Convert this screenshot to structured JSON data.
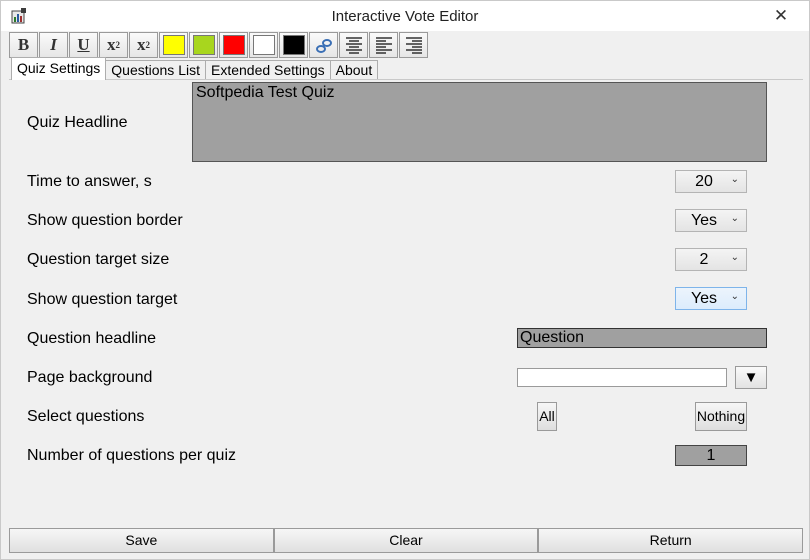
{
  "window": {
    "title": "Interactive Vote Editor",
    "close_glyph": "✕"
  },
  "toolbar": {
    "bold": "B",
    "italic": "I",
    "underline": "U",
    "superscript_base": "x",
    "superscript_exp": "2",
    "subscript_base": "x",
    "subscript_exp": "2",
    "swatches": [
      "#ffff00",
      "#a8d61e",
      "#ff0000",
      "#ffffff",
      "#000000"
    ]
  },
  "tabs": [
    "Quiz Settings",
    "Questions List",
    "Extended Settings",
    "About"
  ],
  "settings": {
    "quiz_headline_label": "Quiz Headline",
    "quiz_headline_value": "Softpedia Test Quiz",
    "time_label": "Time to answer, s",
    "time_value": "20",
    "border_label": "Show question border",
    "border_value": "Yes",
    "target_size_label": "Question target size",
    "target_size_value": "2",
    "show_target_label": "Show question target",
    "show_target_value": "Yes",
    "question_headline_label": "Question headline",
    "question_headline_value": "Question",
    "page_bg_label": "Page background",
    "page_bg_value": "",
    "page_bg_drop": "▼",
    "select_label": "Select questions",
    "select_all": "All",
    "select_nothing": "Nothing",
    "per_quiz_label": "Number of questions per quiz",
    "per_quiz_value": "1"
  },
  "bottom": {
    "save": "Save",
    "clear": "Clear",
    "return": "Return"
  }
}
